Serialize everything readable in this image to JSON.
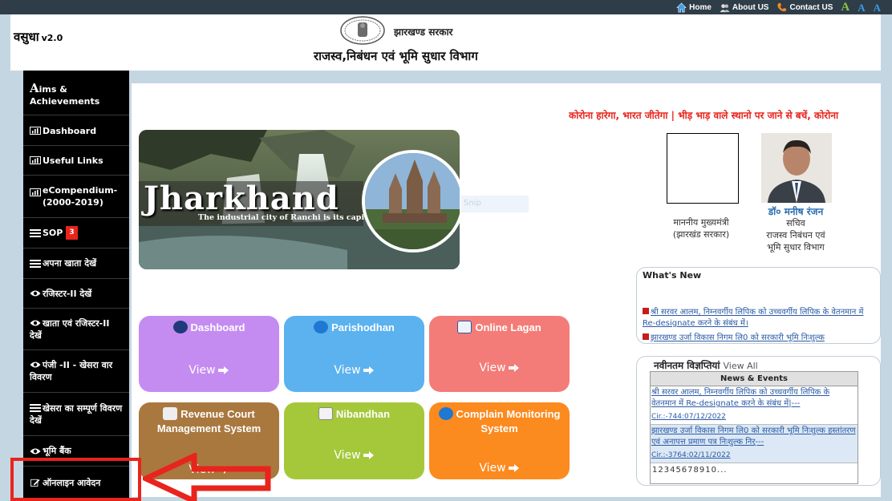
{
  "toplinks": {
    "home": "Home",
    "about": "About US",
    "contact": "Contact US",
    "font_large": "A",
    "font_normal": "A",
    "font_small": "A"
  },
  "header": {
    "app_name": "वसुधा",
    "app_version": "v2.0",
    "gov_name": "झारखण्ड सरकार",
    "dept_name": "राजस्व,निबंधन एवं भूमि सुधार  विभाग"
  },
  "sidebar": {
    "items": [
      {
        "label": "ims & Achievements",
        "icon": "letter-a-icon"
      },
      {
        "label": "Dashboard",
        "icon": "chart-icon"
      },
      {
        "label": "Useful Links",
        "icon": "chart-icon"
      },
      {
        "label": "eCompendium-(2000-2019)",
        "icon": "chart-icon"
      },
      {
        "label": "SOP",
        "badge": "3",
        "icon": "list-icon"
      },
      {
        "label": "अपना खाता देखें",
        "icon": "list-icon"
      },
      {
        "label": "रजिस्टर-II देखें",
        "icon": "eye-icon"
      },
      {
        "label": "खाता एवं रजिस्टर-II देखें",
        "icon": "eye-icon"
      },
      {
        "label": "पंजी -II - खेसरा वार विवरण",
        "icon": "eye-icon"
      },
      {
        "label": "खेसरा का सम्पूर्ण विवरण देखें",
        "icon": "list-icon"
      },
      {
        "label": "भूमि बैंक",
        "icon": "eye-icon"
      },
      {
        "label": "ऑनलाइन आवेदन",
        "icon": "edit-icon"
      }
    ]
  },
  "marquee": "कोरोना हारेगा, भारत जीतेगा | भीड़ भाड़ वाले स्थानो पर जाने से बचें, कोरोना",
  "banner": {
    "title": "Jharkhand",
    "subtitle": "The industrial city of Ranchi is its capital",
    "snip": "Snip"
  },
  "officials": {
    "cm_line1": "माननीय मुख्यमंत्री",
    "cm_line2": "(झारखंड सरकार)",
    "sec_name": "डॉ० मनीष रंजन",
    "sec_designation": "सचिव",
    "sec_dept_line1": "राजस्व निबंधन एवं",
    "sec_dept_line2": "भूमि सुधार विभाग"
  },
  "tiles": [
    {
      "title": "Dashboard",
      "view": "View",
      "color": "#c48cf0"
    },
    {
      "title": "Parishodhan",
      "view": "View",
      "color": "#5cb2ee"
    },
    {
      "title": "Online Lagan",
      "view": "View",
      "color": "#f37c78"
    },
    {
      "title": "Revenue Court Management System",
      "view": "View",
      "color": "#a9783f"
    },
    {
      "title": "Nibandhan",
      "view": "View",
      "color": "#a5c83a"
    },
    {
      "title": "Complain Monitoring System",
      "view": "View",
      "color": "#fb8a1f"
    }
  ],
  "whats_new": {
    "title": "What's New",
    "items": [
      "श्री सरवर आलम, निम्नवर्गीय लिपिक को उच्चवर्गीय लिपिक के वेतनमान में Re-designate करने के संबंध में।",
      "झारखण्ड उर्जा विकास निगम लि0 को सरकारी भूमि निःशुल्क"
    ]
  },
  "notices": {
    "title": "नवीनतम विज्ञप्तियां",
    "view_all": "View All",
    "table_header": "News & Events",
    "rows": [
      {
        "text": "श्री सरवर आलम, निम्नवर्गीय लिपिक को उच्चवर्गीय लिपिक के वेतनमान में Re-designate करने के संबंध में|---",
        "ref": "Cir.:-744:07/12/2022"
      },
      {
        "text": "झारखण्ड उर्जा विकास निगम लि0 को सरकारी भूमि निःशुल्क हस्तांतरण एवं अनापत्त प्रमाण पत्र निःशुल्क निर्---",
        "ref": "Cir.:-3764:02/11/2022"
      }
    ],
    "pages": "12345678910..."
  },
  "colors": {
    "topbar": "#2f3d49",
    "sidebar": "#000000",
    "highlight": "#e8241c",
    "link": "#2a5aa5"
  }
}
